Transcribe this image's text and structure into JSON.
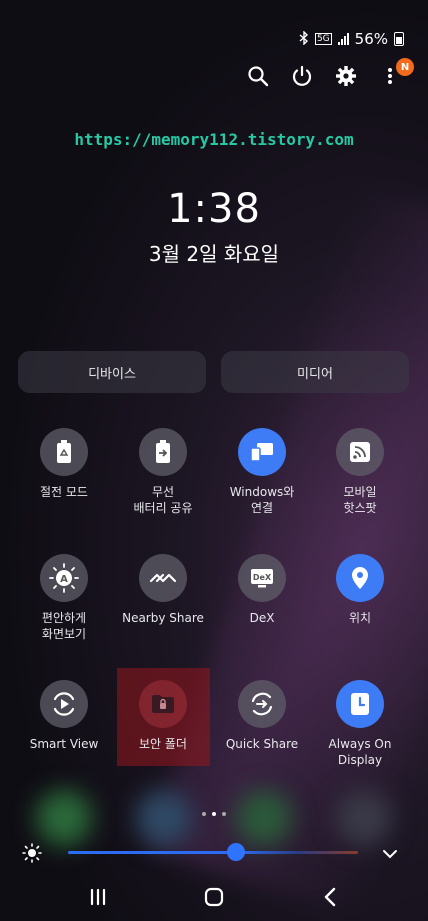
{
  "status_bar": {
    "battery": "56%",
    "network": "5G"
  },
  "header_icons": {
    "notification_badge": "N"
  },
  "watermark": "https://memory112.tistory.com",
  "clock": {
    "time": "1:38",
    "date": "3월 2일 화요일"
  },
  "segments": {
    "devices": "디바이스",
    "media": "미디어"
  },
  "tiles": [
    {
      "label": "절전 모드",
      "icon": "battery-recycle-icon",
      "active": false
    },
    {
      "label": "무선\n배터리 공유",
      "icon": "battery-share-icon",
      "active": false
    },
    {
      "label": "Windows와\n연결",
      "icon": "link-to-windows-icon",
      "active": true
    },
    {
      "label": "모바일\n핫스팟",
      "icon": "hotspot-icon",
      "active": false
    },
    {
      "label": "편안하게\n화면보기",
      "icon": "eye-comfort-icon",
      "active": false
    },
    {
      "label": "Nearby Share",
      "icon": "nearby-share-icon",
      "active": false
    },
    {
      "label": "DeX",
      "icon": "dex-icon",
      "active": false
    },
    {
      "label": "위치",
      "icon": "location-pin-icon",
      "active": true
    },
    {
      "label": "Smart View",
      "icon": "smart-view-icon",
      "active": false
    },
    {
      "label": "보안 폴더",
      "icon": "secure-folder-icon",
      "active": false
    },
    {
      "label": "Quick Share",
      "icon": "quick-share-icon",
      "active": false
    },
    {
      "label": "Always On\nDisplay",
      "icon": "always-on-display-icon",
      "active": true
    }
  ],
  "brightness": {
    "level_percent": 58
  },
  "colors": {
    "accent": "#3d7cf5",
    "watermark": "#27c9a4",
    "badge": "#f26b1d",
    "highlight": "#96161e"
  }
}
